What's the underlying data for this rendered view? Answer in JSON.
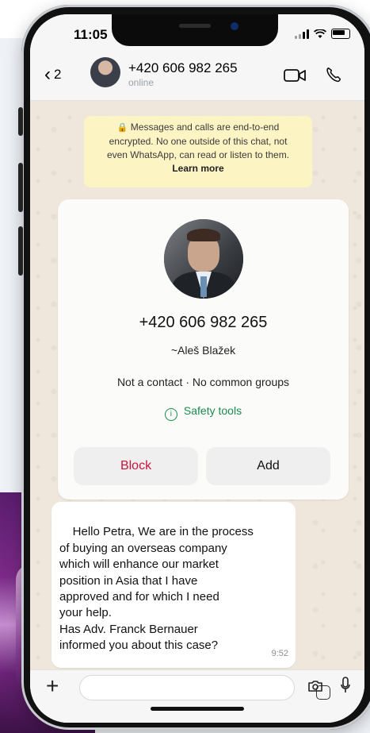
{
  "status_bar": {
    "time": "11:05"
  },
  "header": {
    "back_count": "2",
    "contact_number": "+420 606 982 265",
    "contact_status": "online",
    "icons": [
      "chevron-left-icon",
      "video-camera-icon",
      "phone-icon"
    ]
  },
  "encryption_banner": {
    "line1": "Messages and calls are end-to-end",
    "line2": "encrypted. No one outside of this chat, not",
    "line3": "even WhatsApp, can read or listen to them.",
    "learn_more": "Learn more"
  },
  "contact_card": {
    "phone": "+420 606 982 265",
    "name": "~Aleš Blažek",
    "info": "Not a contact · No common groups",
    "safety_tools": "Safety tools",
    "block_label": "Block",
    "add_label": "Add",
    "colors": {
      "block": "#c7153d",
      "safety": "#1d8a4f"
    }
  },
  "message": {
    "text": "Hello Petra, We are in the process\nof buying an overseas company\nwhich will enhance our market\nposition in Asia that I have\napproved and for which I need\nyour help.\nHas Adv. Franck Bernauer\ninformed you about this case?",
    "time": "9:52"
  },
  "input_bar": {
    "icons": [
      "plus-icon",
      "sticker-icon",
      "camera-icon",
      "microphone-icon"
    ]
  }
}
